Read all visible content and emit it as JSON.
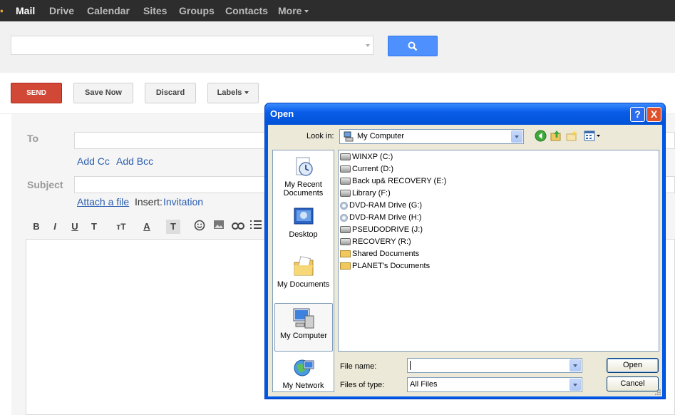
{
  "nav": {
    "items": [
      "Mail",
      "Drive",
      "Calendar",
      "Sites",
      "Groups",
      "Contacts",
      "More"
    ],
    "active": "Mail"
  },
  "search": {
    "value": "",
    "placeholder": ""
  },
  "toolbar": {
    "send": "SEND",
    "save": "Save Now",
    "discard": "Discard",
    "labels": "Labels"
  },
  "compose": {
    "to_label": "To",
    "to_value": "",
    "add_cc": "Add Cc",
    "add_bcc": "Add Bcc",
    "subject_label": "Subject",
    "subject_value": "",
    "attach": "Attach a file",
    "insert_label": "Insert:",
    "insert_link": "Invitation"
  },
  "format": [
    "B",
    "I",
    "U",
    "T",
    "ᴛT",
    "A",
    "T"
  ],
  "dialog": {
    "title": "Open",
    "look_in_label": "Look in:",
    "look_in_value": "My Computer",
    "places": [
      {
        "label": "My Recent Documents",
        "icon": "recent-documents-icon"
      },
      {
        "label": "Desktop",
        "icon": "desktop-icon"
      },
      {
        "label": "My Documents",
        "icon": "my-documents-folder-icon"
      },
      {
        "label": "My Computer",
        "icon": "my-computer-icon"
      },
      {
        "label": "My Network",
        "icon": "my-network-icon"
      }
    ],
    "files": [
      {
        "name": "WINXP (C:)",
        "kind": "drive"
      },
      {
        "name": "Current (D:)",
        "kind": "drive"
      },
      {
        "name": "Back up& RECOVERY (E:)",
        "kind": "drive"
      },
      {
        "name": "Library (F:)",
        "kind": "drive"
      },
      {
        "name": "DVD-RAM Drive (G:)",
        "kind": "cd"
      },
      {
        "name": "DVD-RAM Drive (H:)",
        "kind": "cd"
      },
      {
        "name": "PSEUDODRIVE (J:)",
        "kind": "drive"
      },
      {
        "name": "RECOVERY (R:)",
        "kind": "drive"
      },
      {
        "name": "Shared Documents",
        "kind": "folder"
      },
      {
        "name": "PLANET's Documents",
        "kind": "folder"
      }
    ],
    "file_name_label": "File name:",
    "file_name_value": "",
    "file_type_label": "Files of type:",
    "file_type_value": "All Files",
    "open_button": "Open",
    "cancel_button": "Cancel",
    "help_button": "?",
    "close_button": "X"
  },
  "colors": {
    "send": "#d14836",
    "search_button": "#4d90fe",
    "link": "#2a5db0",
    "xp_title": "#0a5de8"
  }
}
